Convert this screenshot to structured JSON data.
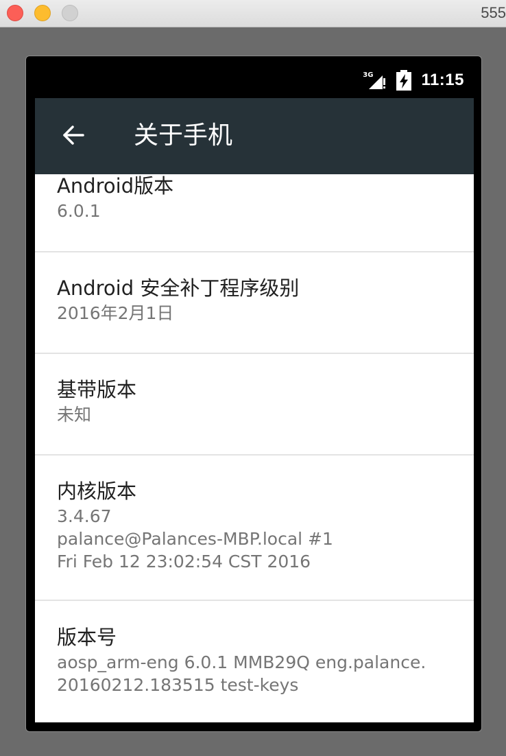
{
  "window": {
    "title": "555"
  },
  "status_bar": {
    "network_type": "3G",
    "time": "11:15"
  },
  "toolbar": {
    "title": "关于手机"
  },
  "items": [
    {
      "title": "Android版本",
      "summary": "6.0.1"
    },
    {
      "title": "Android 安全补丁程序级别",
      "summary": "2016年2月1日"
    },
    {
      "title": "基带版本",
      "summary": "未知"
    },
    {
      "title": "内核版本",
      "summary": "3.4.67\npalance@Palances-MBP.local #1\nFri Feb 12 23:02:54 CST 2016"
    },
    {
      "title": "版本号",
      "summary": "aosp_arm-eng 6.0.1 MMB29Q eng.palance.\n20160212.183515 test-keys"
    }
  ],
  "colors": {
    "toolbar": "#263238",
    "title_text": "#212121",
    "summary_text": "#757575",
    "divider": "#e3e3e3"
  },
  "icons": {
    "back": "arrow-left-icon",
    "signal": "cell-signal-icon",
    "battery": "battery-charging-icon"
  }
}
